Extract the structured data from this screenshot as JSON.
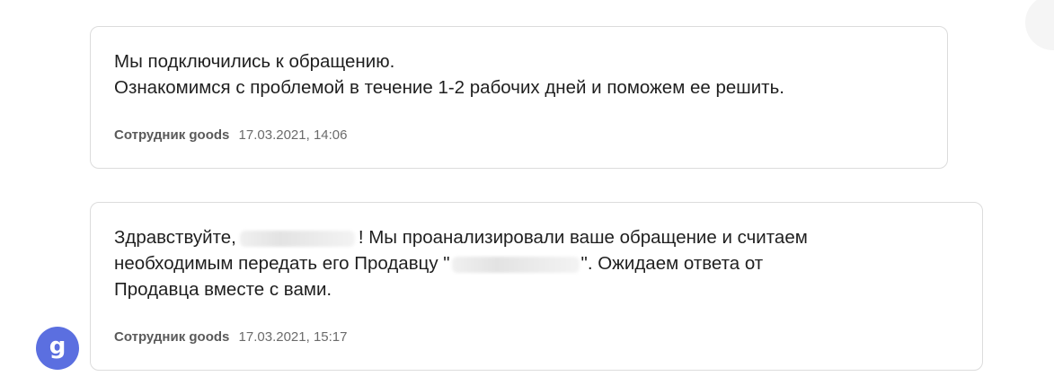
{
  "messages": [
    {
      "text_line1": "Мы подключились к обращению.",
      "text_line2": "Ознакомимся с проблемой в течение 1-2 рабочих дней и поможем ее решить.",
      "author": "Сотрудник goods",
      "timestamp": "17.03.2021, 14:06"
    },
    {
      "greeting": "Здравствуйте,",
      "after_name": "! Мы проанализировали ваше обращение и считаем",
      "line2_start": "необходимым передать его Продавцу \"",
      "line2_end": "\". Ожидаем ответа от",
      "line3": "Продавца вместе с вами.",
      "author": "Сотрудник goods",
      "timestamp": "17.03.2021, 15:17"
    }
  ],
  "avatar": {
    "letter": "g",
    "color": "#5b6fe0"
  }
}
